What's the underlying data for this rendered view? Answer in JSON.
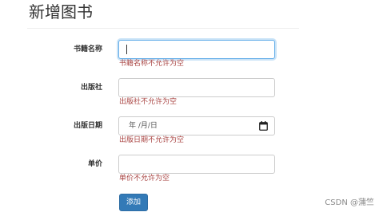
{
  "page": {
    "title": "新增图书"
  },
  "form": {
    "fields": [
      {
        "label": "书籍名称",
        "value": "",
        "error": "书籍名称不允许为空"
      },
      {
        "label": "出版社",
        "value": "",
        "error": "出版社不允许为空"
      },
      {
        "label": "出版日期",
        "value": "",
        "display": "年 /月/日",
        "icon": "calendar-icon",
        "error": "出版日期不允许为空"
      },
      {
        "label": "单价",
        "value": "",
        "error": "单价不允许为空"
      }
    ],
    "submit_label": "添加"
  },
  "colors": {
    "error": "#a94442",
    "button": "#337ab7",
    "focus_border": "#66afe9"
  },
  "watermark": "CSDN @蒲竺"
}
